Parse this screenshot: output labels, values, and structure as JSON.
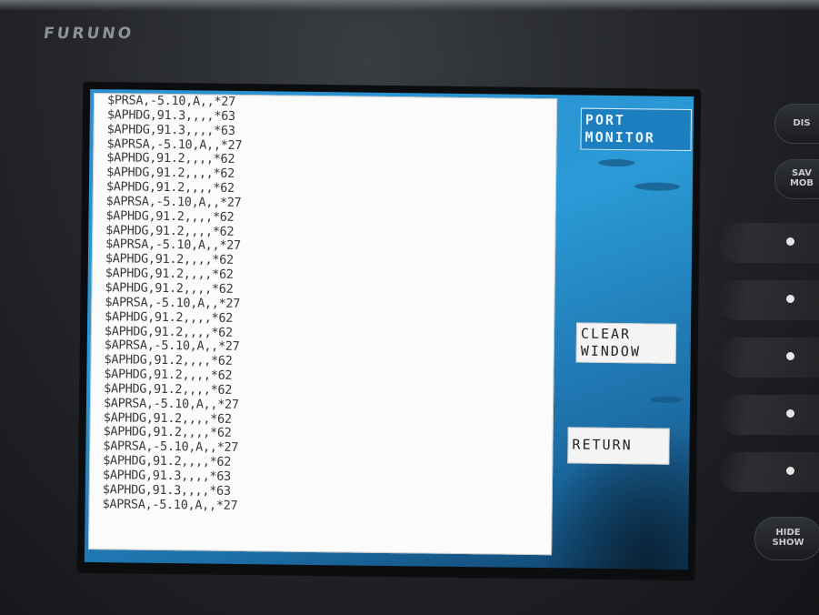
{
  "device": {
    "brand": "FURUNO"
  },
  "screen": {
    "title_line1": "PORT",
    "title_line2": "MONITOR",
    "clear_line1": "CLEAR",
    "clear_line2": "WINDOW",
    "return_label": "RETURN",
    "log_lines": [
      "$PRSA,-5.10,A,,*27",
      "$APHDG,91.3,,,,*63",
      "$APHDG,91.3,,,,*63",
      "$APRSA,-5.10,A,,*27",
      "$APHDG,91.2,,,,*62",
      "$APHDG,91.2,,,,*62",
      "$APHDG,91.2,,,,*62",
      "$APRSA,-5.10,A,,*27",
      "$APHDG,91.2,,,,*62",
      "$APHDG,91.2,,,,*62",
      "$APRSA,-5.10,A,,*27",
      "$APHDG,91.2,,,,*62",
      "$APHDG,91.2,,,,*62",
      "$APHDG,91.2,,,,*62",
      "$APRSA,-5.10,A,,*27",
      "$APHDG,91.2,,,,*62",
      "$APHDG,91.2,,,,*62",
      "$APRSA,-5.10,A,,*27",
      "$APHDG,91.2,,,,*62",
      "$APHDG,91.2,,,,*62",
      "$APHDG,91.2,,,,*62",
      "$APRSA,-5.10,A,,*27",
      "$APHDG,91.2,,,,*62",
      "$APHDG,91.2,,,,*62",
      "$APRSA,-5.10,A,,*27",
      "$APHDG,91.2,,,,*62",
      "$APHDG,91.3,,,,*63",
      "$APHDG,91.3,,,,*63",
      "$APRSA,-5.10,A,,*27"
    ]
  },
  "hardware_keys": {
    "disp": "DIS",
    "save_line1": "SAV",
    "save_line2": "MOB",
    "hide_line1": "HIDE",
    "hide_line2": "SHOW"
  }
}
